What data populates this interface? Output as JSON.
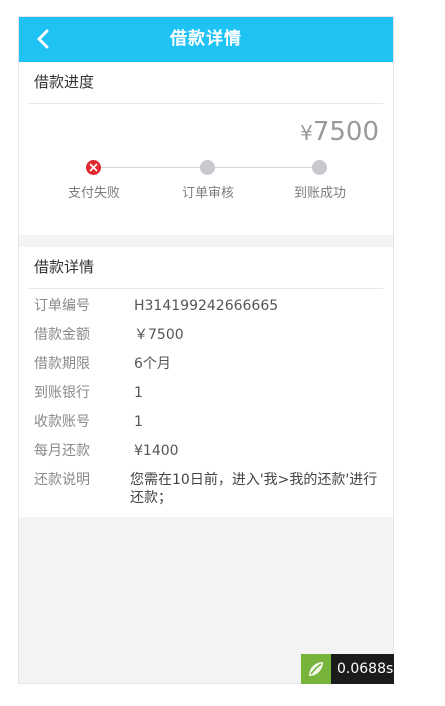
{
  "navbar": {
    "title": "借款详情",
    "back_icon": "chevron-left-icon"
  },
  "progress": {
    "header": "借款进度",
    "amount_symbol": "¥",
    "amount_value": "7500",
    "steps": [
      {
        "label": "支付失败",
        "status": "failed"
      },
      {
        "label": "订单审核",
        "status": "pending"
      },
      {
        "label": "到账成功",
        "status": "pending"
      }
    ]
  },
  "details": {
    "header": "借款详情",
    "rows": [
      {
        "label": "订单编号",
        "value": "H314199242666665"
      },
      {
        "label": "借款金额",
        "value": "￥7500"
      },
      {
        "label": "借款期限",
        "value": "6个月"
      },
      {
        "label": "到账银行",
        "value": "1"
      },
      {
        "label": "收款账号",
        "value": "1"
      },
      {
        "label": "每月还款",
        "value": "¥1400"
      },
      {
        "label": "还款说明",
        "value": "您需在10日前，进入'我>我的还款'进行还款；"
      }
    ]
  },
  "perf_badge": {
    "time": "0.0688s"
  },
  "colors": {
    "primary": "#1ec3f3",
    "failed": "#e0292e",
    "pending": "#c9c9cd"
  }
}
